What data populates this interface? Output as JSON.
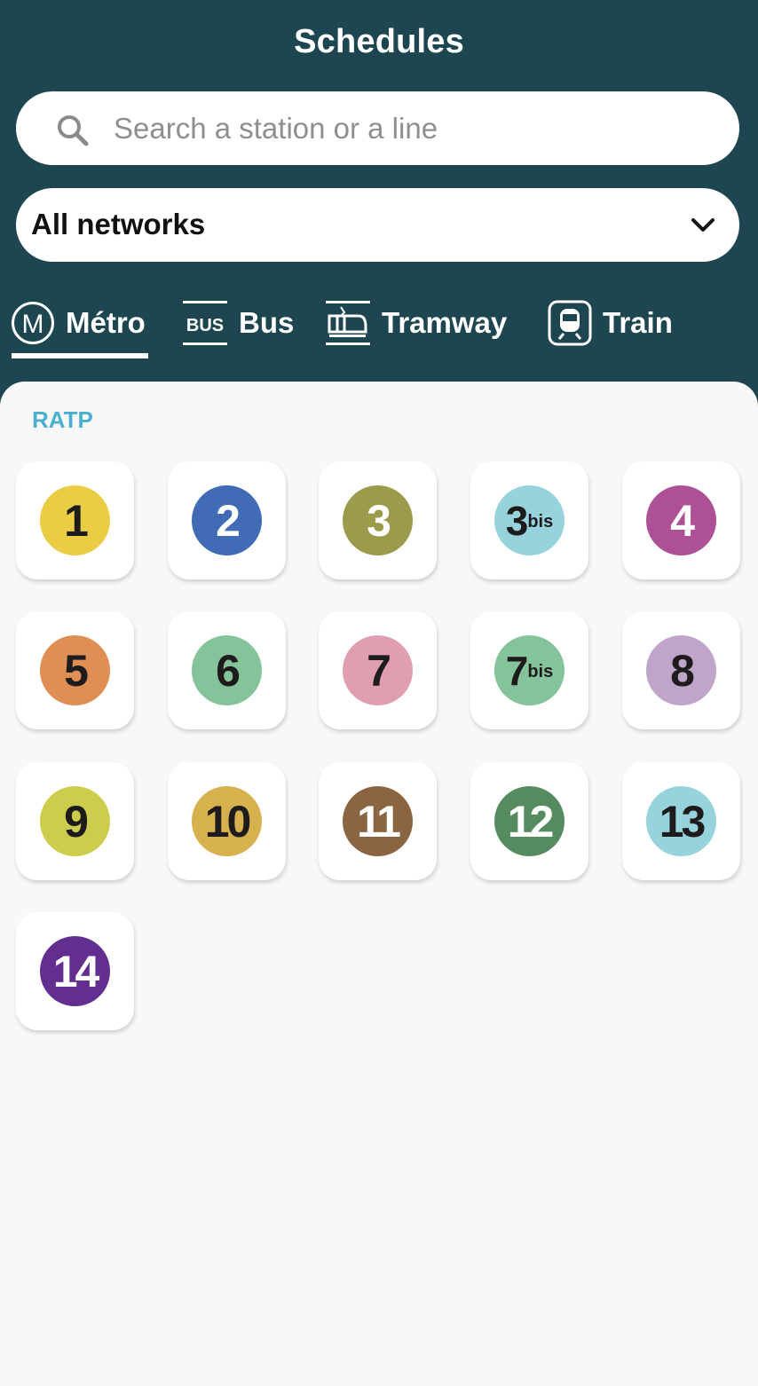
{
  "header": {
    "title": "Schedules",
    "search": {
      "placeholder": "Search a station or a line",
      "value": ""
    },
    "network_select": {
      "selected": "All networks"
    }
  },
  "tabs": [
    {
      "label": "Métro",
      "icon": "metro-icon",
      "active": true
    },
    {
      "label": "Bus",
      "icon": "bus-icon",
      "active": false
    },
    {
      "label": "Tramway",
      "icon": "tramway-icon",
      "active": false
    },
    {
      "label": "Train",
      "icon": "train-icon",
      "active": false
    }
  ],
  "bus_icon_text": "BUS",
  "metro_icon_text": "M",
  "section": {
    "title": "RATP"
  },
  "lines": [
    {
      "number": "1",
      "suffix": "",
      "bg": "#ebcd45",
      "fg": "#1d1b1c"
    },
    {
      "number": "2",
      "suffix": "",
      "bg": "#416bb5",
      "fg": "#ffffff"
    },
    {
      "number": "3",
      "suffix": "",
      "bg": "#9c9a4b",
      "fg": "#ffffff"
    },
    {
      "number": "3",
      "suffix": "bis",
      "bg": "#96d3dc",
      "fg": "#1d1b1c"
    },
    {
      "number": "4",
      "suffix": "",
      "bg": "#ad5096",
      "fg": "#ffffff"
    },
    {
      "number": "5",
      "suffix": "",
      "bg": "#df8f53",
      "fg": "#1d1b1c"
    },
    {
      "number": "6",
      "suffix": "",
      "bg": "#85c39a",
      "fg": "#1d1b1c"
    },
    {
      "number": "7",
      "suffix": "",
      "bg": "#df9fb1",
      "fg": "#1d1b1c"
    },
    {
      "number": "7",
      "suffix": "bis",
      "bg": "#85c39a",
      "fg": "#1d1b1c"
    },
    {
      "number": "8",
      "suffix": "",
      "bg": "#c0a5ca",
      "fg": "#1d1b1c"
    },
    {
      "number": "9",
      "suffix": "",
      "bg": "#cdcd4d",
      "fg": "#1d1b1c"
    },
    {
      "number": "10",
      "suffix": "",
      "bg": "#d6b14e",
      "fg": "#1d1b1c"
    },
    {
      "number": "11",
      "suffix": "",
      "bg": "#8b6541",
      "fg": "#ffffff"
    },
    {
      "number": "12",
      "suffix": "",
      "bg": "#568b5f",
      "fg": "#ffffff"
    },
    {
      "number": "13",
      "suffix": "",
      "bg": "#96d3dc",
      "fg": "#1d1b1c"
    },
    {
      "number": "14",
      "suffix": "",
      "bg": "#622f90",
      "fg": "#ffffff"
    }
  ]
}
